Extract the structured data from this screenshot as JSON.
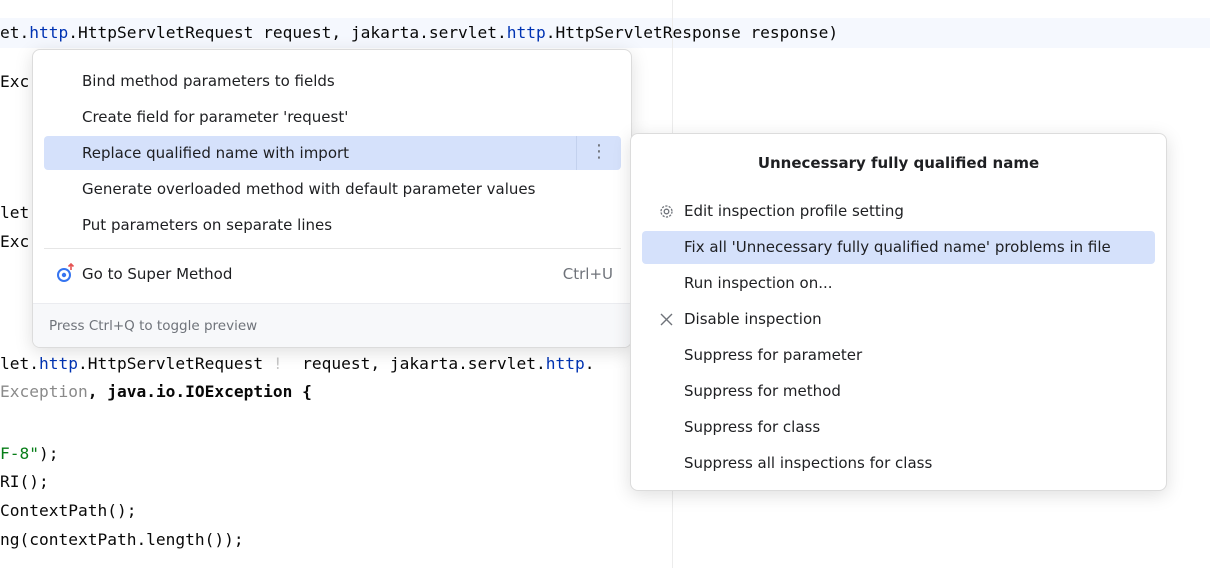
{
  "editor": {
    "lines": [
      {
        "segments": [
          {
            "t": "et."
          },
          {
            "t": "http",
            "c": "kw"
          },
          {
            "t": ".HttpServletRequest request, jakarta.servlet."
          },
          {
            "t": "http",
            "c": "kw"
          },
          {
            "t": ".HttpServletResponse response)"
          }
        ]
      },
      {
        "segments": [
          {
            "t": "Exc"
          }
        ]
      },
      {
        "segments": [
          {
            "t": "let"
          }
        ]
      },
      {
        "segments": [
          {
            "t": "Exc"
          }
        ]
      },
      {
        "segments": [
          {
            "t": "let."
          },
          {
            "t": "http",
            "c": "kw"
          },
          {
            "t": ".HttpServletRequest "
          },
          {
            "t": "!",
            "c": "mk"
          },
          {
            "t": "  request, jakarta.servlet."
          },
          {
            "t": "http",
            "c": "kw"
          },
          {
            "t": "."
          }
        ]
      },
      {
        "segments": [
          {
            "t": "Exception",
            "c": "dim"
          },
          {
            "t": ", java.io.IOException {",
            "c": "bold"
          }
        ]
      },
      {
        "segments": [
          {
            "t": "F-8\"",
            "c": "str"
          },
          {
            "t": ");"
          }
        ]
      },
      {
        "segments": [
          {
            "t": "RI();"
          }
        ]
      },
      {
        "segments": [
          {
            "t": "ContextPath();"
          }
        ]
      },
      {
        "segments": [
          {
            "t": "ng(contextPath.length());"
          }
        ]
      }
    ]
  },
  "intentions": {
    "items": [
      "Bind method parameters to fields",
      "Create field for parameter 'request'",
      "Replace qualified name with import",
      "Generate overloaded method with default parameter values",
      "Put parameters on separate lines"
    ],
    "selected_index": 2,
    "more_icon": "vertical-dots-icon",
    "super_method": {
      "label": "Go to Super Method",
      "shortcut": "Ctrl+U",
      "icon": "super-method-icon"
    },
    "footer_hint": "Press Ctrl+Q to toggle preview"
  },
  "inspection": {
    "title": "Unnecessary fully qualified name",
    "items": [
      {
        "label": "Edit inspection profile setting",
        "icon": "settings-icon"
      },
      {
        "label": "Fix all 'Unnecessary fully qualified name' problems in file",
        "icon": ""
      },
      {
        "label": "Run inspection on...",
        "icon": ""
      },
      {
        "label": "Disable inspection",
        "icon": "close-icon"
      },
      {
        "label": "Suppress for parameter",
        "icon": ""
      },
      {
        "label": "Suppress for method",
        "icon": ""
      },
      {
        "label": "Suppress for class",
        "icon": ""
      },
      {
        "label": "Suppress all inspections for class",
        "icon": ""
      }
    ],
    "selected_index": 1
  },
  "colors": {
    "selection": "#d5e1fb",
    "keyword": "#0033b3",
    "string": "#067d17",
    "accent_icon": "#3574f0"
  }
}
